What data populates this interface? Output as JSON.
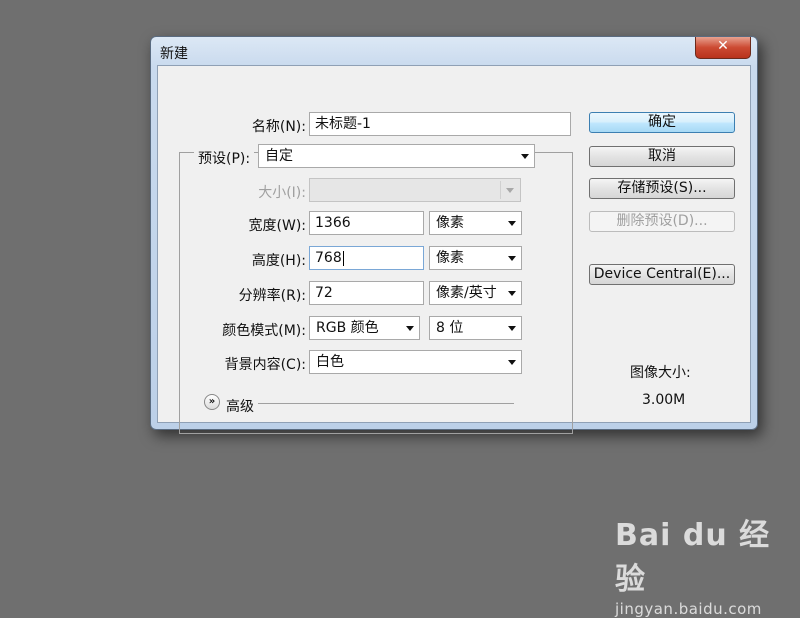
{
  "window": {
    "title": "新建",
    "close_glyph": "✕"
  },
  "form": {
    "name_label": "名称(N):",
    "name_value": "未标题-1",
    "preset_label": "预设(P):",
    "preset_value": "自定",
    "size_label": "大小(I):",
    "size_value": "",
    "width_label": "宽度(W):",
    "width_value": "1366",
    "width_unit": "像素",
    "height_label": "高度(H):",
    "height_value": "768",
    "height_unit": "像素",
    "resolution_label": "分辨率(R):",
    "resolution_value": "72",
    "resolution_unit": "像素/英寸",
    "color_mode_label": "颜色模式(M):",
    "color_mode_value": "RGB 颜色",
    "bit_depth_value": "8 位",
    "background_label": "背景内容(C):",
    "background_value": "白色",
    "advanced_label": "高级",
    "advanced_icon": "chevron-double-down-icon"
  },
  "buttons": {
    "ok": "确定",
    "cancel": "取消",
    "save_preset": "存储预设(S)...",
    "delete_preset": "删除预设(D)...",
    "device_central": "Device Central(E)..."
  },
  "image_size": {
    "label": "图像大小:",
    "value": "3.00M"
  },
  "watermark": {
    "brand": "Bai du 经验",
    "url": "jingyan.baidu.com"
  },
  "colors": {
    "desktop": "#6f6f6f",
    "dialog_frame": "#c9daee",
    "close_button": "#cc4a32",
    "primary_button": "#bee6fd"
  }
}
